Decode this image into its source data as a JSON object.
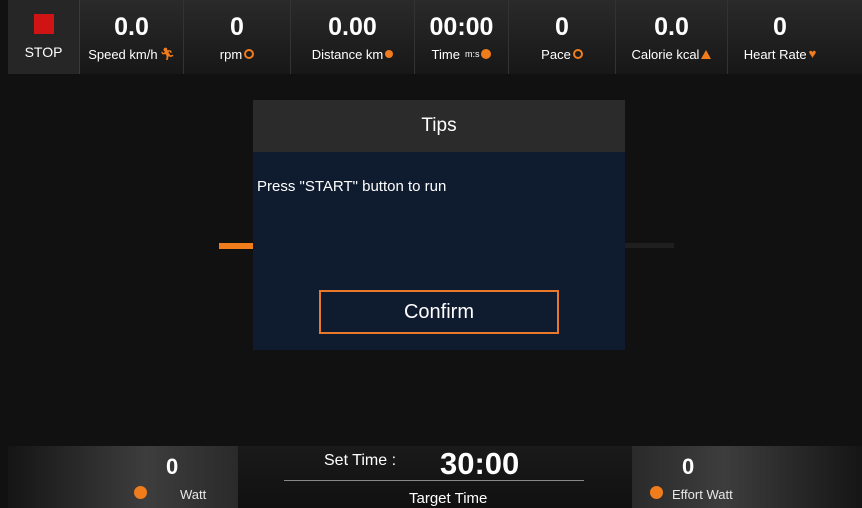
{
  "topbar": {
    "stop_label": "STOP",
    "stats": [
      {
        "value": "0.0",
        "label": "Speed km/h",
        "icon": "runner-icon"
      },
      {
        "value": "0",
        "label": "rpm",
        "icon": "rpm-icon"
      },
      {
        "value": "0.00",
        "label": "Distance km",
        "icon": "distance-icon"
      },
      {
        "value": "00:00",
        "label": "Time",
        "unit": "m:s",
        "icon": "clock-icon"
      },
      {
        "value": "0",
        "label": "Pace",
        "icon": "pace-icon"
      },
      {
        "value": "0.0",
        "label": "Calorie kcal",
        "icon": "flame-icon"
      },
      {
        "value": "0",
        "label": "Heart Rate",
        "icon": "heart-icon"
      }
    ]
  },
  "dialog": {
    "title": "Tips",
    "message": "Press \"START\" button to run",
    "confirm_label": "Confirm"
  },
  "bottombar": {
    "watt_value": "0",
    "watt_label": "Watt",
    "set_time_label": "Set Time :",
    "set_time_value": "30:00",
    "target_time_label": "Target Time",
    "effort_value": "0",
    "effort_label": "Effort Watt"
  },
  "colors": {
    "accent": "#f07c1c",
    "stop_red": "#d01414",
    "dialog_body": "#0f1b2e"
  }
}
